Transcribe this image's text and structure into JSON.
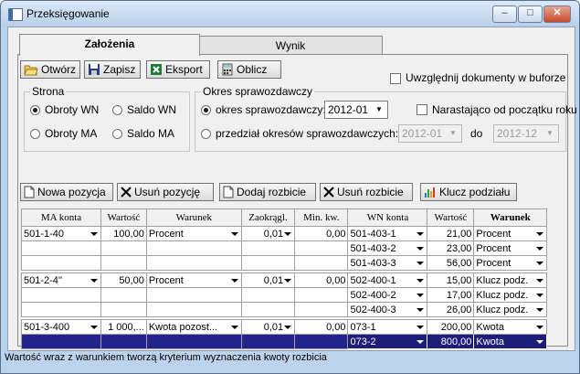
{
  "window": {
    "title": "Przeksięgowanie",
    "minimize_glyph": "–",
    "maximize_glyph": "□",
    "close_glyph": "✕"
  },
  "tabs": [
    {
      "label": "Założenia"
    },
    {
      "label": "Wynik"
    }
  ],
  "toolbar": {
    "open_label": "Otwórz",
    "save_label": "Zapisz",
    "export_label": "Eksport",
    "calculate_label": "Oblicz",
    "buffer_checkbox_label": "Uwzględnij dokumenty w buforze"
  },
  "strona": {
    "legend": "Strona",
    "options": [
      "Obroty WN",
      "Saldo WN",
      "Obroty MA",
      "Saldo MA"
    ],
    "selected": "Obroty WN"
  },
  "okres": {
    "legend": "Okres sprawozdawczy",
    "option_period_label": "okres sprawozdawczy:",
    "period_value": "2012-01",
    "cumulative_label": "Narastająco od początku roku",
    "option_range_label": "przedział okresów sprawozdawczych: od",
    "range_from": "2012-01",
    "range_to_label": "do",
    "range_to": "2012-12"
  },
  "actions": {
    "new_position": "Nowa pozycja",
    "delete_position": "Usuń pozycję",
    "add_split": "Dodaj rozbicie",
    "delete_split": "Usuń rozbicie",
    "split_key": "Klucz podziału"
  },
  "grid": {
    "headers": [
      "MA konta",
      "Wartość",
      "Warunek",
      "Zaokrągl.",
      "Min. kw.",
      "WN konta",
      "Wartość",
      "Warunek"
    ],
    "groups": [
      {
        "ma_account": "501-1-40",
        "value": "100,00",
        "condition": "Procent",
        "rounding": "0,01",
        "min": "0,00",
        "splits": [
          {
            "wn": "501-403-1",
            "value": "21,00",
            "condition": "Procent"
          },
          {
            "wn": "501-403-2",
            "value": "23,00",
            "condition": "Procent"
          },
          {
            "wn": "501-403-3",
            "value": "56,00",
            "condition": "Procent"
          }
        ]
      },
      {
        "ma_account": "501-2-4''",
        "value": "50,00",
        "condition": "Procent",
        "rounding": "0,01",
        "min": "0,00",
        "splits": [
          {
            "wn": "502-400-1",
            "value": "15,00",
            "condition": "Klucz podz."
          },
          {
            "wn": "502-400-2",
            "value": "17,00",
            "condition": "Klucz podz."
          },
          {
            "wn": "502-400-3",
            "value": "26,00",
            "condition": "Klucz podz."
          }
        ]
      },
      {
        "ma_account": "501-3-400",
        "value": "1 000,...",
        "condition": "Kwota pozost...",
        "rounding": "0,01",
        "min": "0,00",
        "splits": [
          {
            "wn": "073-1",
            "value": "200,00",
            "condition": "Kwota"
          },
          {
            "wn": "073-2",
            "value": "800,00",
            "condition": "Kwota",
            "selected": true
          }
        ]
      }
    ]
  },
  "status_bar": "Wartość wraz z warunkiem tworzą kryterium wyznaczenia kwoty rozbicia"
}
